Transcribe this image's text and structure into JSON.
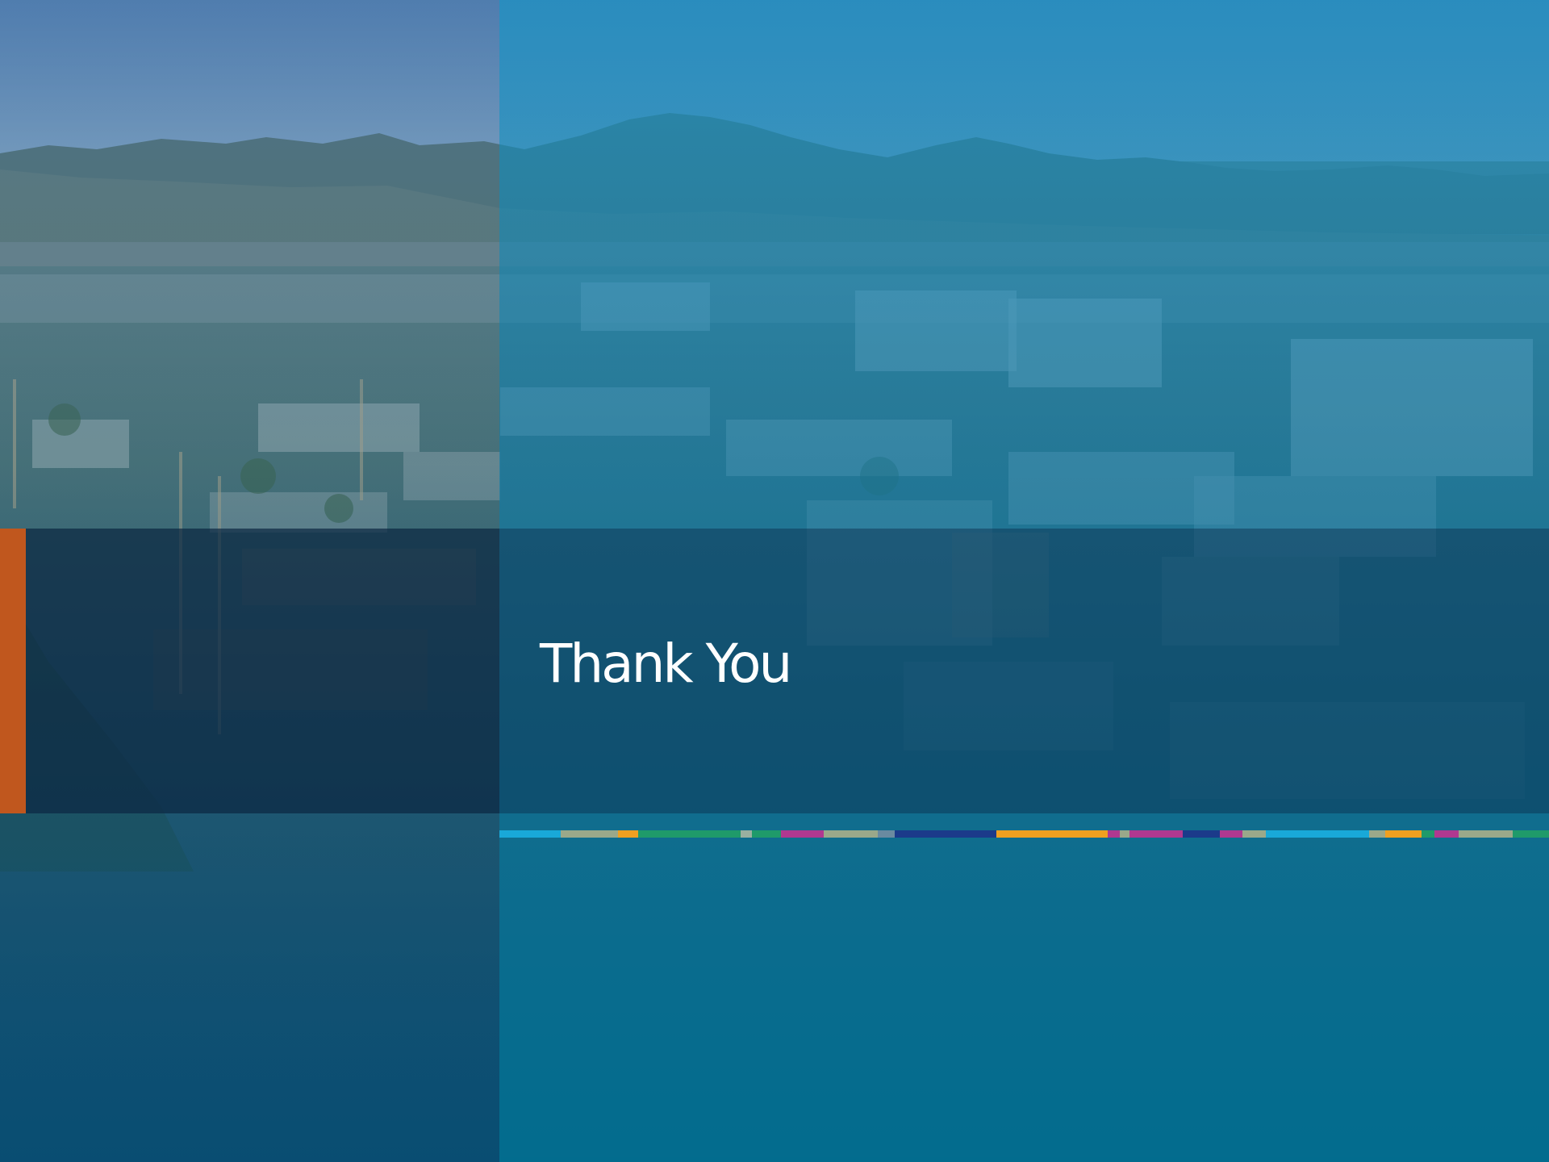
{
  "slide": {
    "title": "Thank You"
  },
  "colors": {
    "accent_orange": "#c0571e",
    "left_panel_tint": "#2a5c8a",
    "right_panel_tint": "#1e84b4",
    "title_text": "#ffffff"
  },
  "color_strip": [
    {
      "color": "#19a8d8",
      "weight": 75
    },
    {
      "color": "#9aa88a",
      "weight": 70
    },
    {
      "color": "#f0a020",
      "weight": 24
    },
    {
      "color": "#1f9a6a",
      "weight": 125
    },
    {
      "color": "#9ab0a0",
      "weight": 14
    },
    {
      "color": "#1f9a6a",
      "weight": 36
    },
    {
      "color": "#b03890",
      "weight": 52
    },
    {
      "color": "#9aa88a",
      "weight": 66
    },
    {
      "color": "#6a8aa0",
      "weight": 20
    },
    {
      "color": "#1b3a8a",
      "weight": 125
    },
    {
      "color": "#f0a020",
      "weight": 135
    },
    {
      "color": "#b03890",
      "weight": 15
    },
    {
      "color": "#9aa88a",
      "weight": 12
    },
    {
      "color": "#b03890",
      "weight": 65
    },
    {
      "color": "#1b3a8a",
      "weight": 45
    },
    {
      "color": "#b03890",
      "weight": 28
    },
    {
      "color": "#9aa88a",
      "weight": 28
    },
    {
      "color": "#19a8d8",
      "weight": 126
    },
    {
      "color": "#9aa88a",
      "weight": 20
    },
    {
      "color": "#f0a020",
      "weight": 44
    },
    {
      "color": "#1f9a6a",
      "weight": 16
    },
    {
      "color": "#b03890",
      "weight": 30
    },
    {
      "color": "#9aa88a",
      "weight": 66
    },
    {
      "color": "#1f9a6a",
      "weight": 44
    }
  ]
}
